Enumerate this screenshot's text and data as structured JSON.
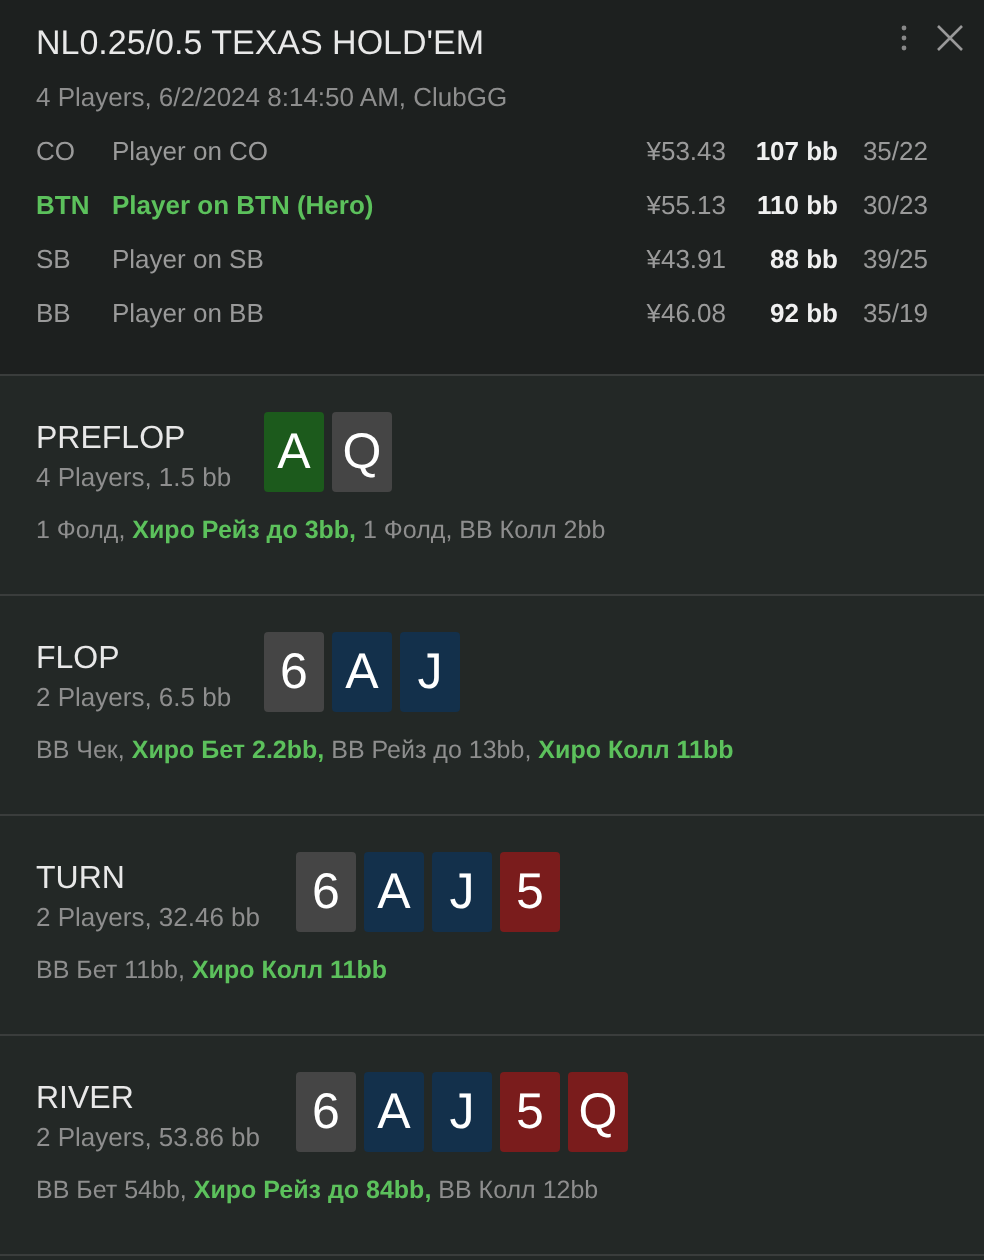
{
  "header": {
    "title": "NL0.25/0.5 TEXAS HOLD'EM",
    "subtitle": "4 Players, 6/2/2024 8:14:50 AM, ClubGG"
  },
  "players": [
    {
      "position": "CO",
      "name": "Player on CO",
      "stack": "¥53.43",
      "bb": "107 bb",
      "stats": "35/22",
      "hero": false
    },
    {
      "position": "BTN",
      "name": "Player on BTN (Hero)",
      "stack": "¥55.13",
      "bb": "110 bb",
      "stats": "30/23",
      "hero": true
    },
    {
      "position": "SB",
      "name": "Player on SB",
      "stack": "¥43.91",
      "bb": "88 bb",
      "stats": "39/25",
      "hero": false
    },
    {
      "position": "BB",
      "name": "Player on BB",
      "stack": "¥46.08",
      "bb": "92 bb",
      "stats": "35/19",
      "hero": false
    }
  ],
  "streets": [
    {
      "name": "PREFLOP",
      "info": "4 Players, 1.5 bb",
      "cards": [
        {
          "rank": "A",
          "color": "#1c5a1c"
        },
        {
          "rank": "Q",
          "color": "#454545"
        }
      ],
      "actions": [
        {
          "text": "1 Фолд,",
          "hero": false
        },
        {
          "text": "Хиро Рейз до 3bb,",
          "hero": true
        },
        {
          "text": "1 Фолд, BB Колл 2bb",
          "hero": false
        }
      ]
    },
    {
      "name": "FLOP",
      "info": "2 Players, 6.5 bb",
      "cards": [
        {
          "rank": "6",
          "color": "#454545"
        },
        {
          "rank": "A",
          "color": "#13304b"
        },
        {
          "rank": "J",
          "color": "#13304b"
        }
      ],
      "actions": [
        {
          "text": "BB Чек,",
          "hero": false
        },
        {
          "text": "Хиро Бет 2.2bb,",
          "hero": true
        },
        {
          "text": "BB Рейз до 13bb,",
          "hero": false
        },
        {
          "text": "Хиро Колл 11bb",
          "hero": true
        }
      ]
    },
    {
      "name": "TURN",
      "info": "2 Players, 32.46 bb",
      "cards": [
        {
          "rank": "6",
          "color": "#454545"
        },
        {
          "rank": "A",
          "color": "#13304b"
        },
        {
          "rank": "J",
          "color": "#13304b"
        },
        {
          "rank": "5",
          "color": "#7a1c1c"
        }
      ],
      "actions": [
        {
          "text": "BB Бет 11bb,",
          "hero": false
        },
        {
          "text": "Хиро Колл 11bb",
          "hero": true
        }
      ]
    },
    {
      "name": "RIVER",
      "info": "2 Players, 53.86 bb",
      "cards": [
        {
          "rank": "6",
          "color": "#454545"
        },
        {
          "rank": "A",
          "color": "#13304b"
        },
        {
          "rank": "J",
          "color": "#13304b"
        },
        {
          "rank": "5",
          "color": "#7a1c1c"
        },
        {
          "rank": "Q",
          "color": "#7a1c1c"
        }
      ],
      "actions": [
        {
          "text": "BB Бет 54bb,",
          "hero": false
        },
        {
          "text": "Хиро Рейз до 84bb,",
          "hero": true
        },
        {
          "text": "BB Колл 12bb",
          "hero": false
        }
      ]
    }
  ]
}
